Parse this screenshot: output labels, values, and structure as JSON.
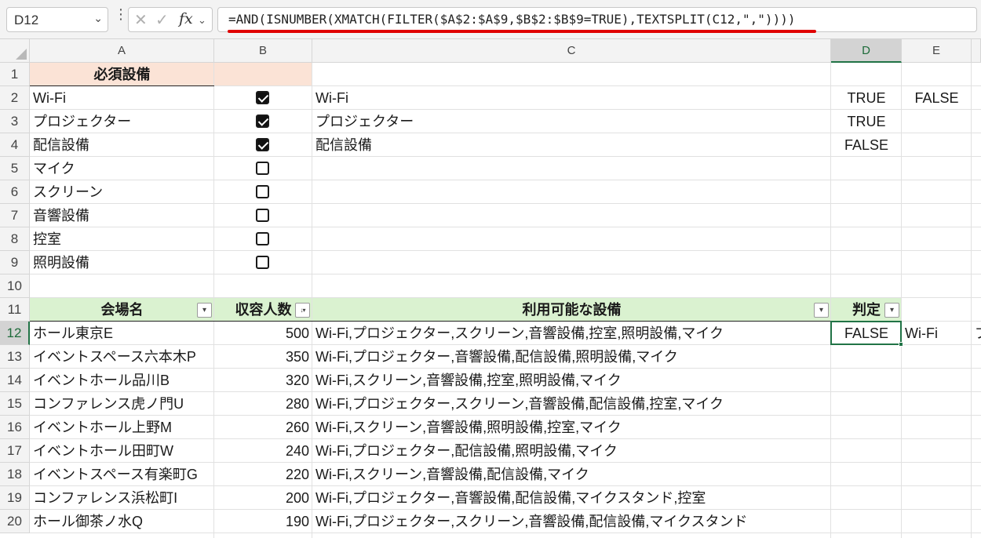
{
  "name_box": "D12",
  "formula": "=AND(ISNUMBER(XMATCH(FILTER($A$2:$A$9,$B$2:$B$9=TRUE),TEXTSPLIT(C12,\",\"))))",
  "columns": [
    "A",
    "B",
    "C",
    "D",
    "E"
  ],
  "rows": [
    "1",
    "2",
    "3",
    "4",
    "5",
    "6",
    "7",
    "8",
    "9",
    "10",
    "11",
    "12",
    "13",
    "14",
    "15",
    "16",
    "17",
    "18",
    "19",
    "20"
  ],
  "required_header": "必須設備",
  "equipment": [
    {
      "name": "Wi-Fi",
      "checked": true
    },
    {
      "name": "プロジェクター",
      "checked": true
    },
    {
      "name": "配信設備",
      "checked": true
    },
    {
      "name": "マイク",
      "checked": false
    },
    {
      "name": "スクリーン",
      "checked": false
    },
    {
      "name": "音響設備",
      "checked": false
    },
    {
      "name": "控室",
      "checked": false
    },
    {
      "name": "照明設備",
      "checked": false
    }
  ],
  "spill_c": [
    "Wi-Fi",
    "プロジェクター",
    "配信設備"
  ],
  "spill_d": [
    "TRUE",
    "TRUE",
    "FALSE"
  ],
  "e2": "FALSE",
  "table_headers": {
    "venue": "会場名",
    "capacity": "収容人数",
    "equipment": "利用可能な設備",
    "judgment": "判定"
  },
  "venues": [
    {
      "name": "ホール東京E",
      "capacity": "500",
      "equipment": "Wi-Fi,プロジェクター,スクリーン,音響設備,控室,照明設備,マイク"
    },
    {
      "name": "イベントスペース六本木P",
      "capacity": "350",
      "equipment": "Wi-Fi,プロジェクター,音響設備,配信設備,照明設備,マイク"
    },
    {
      "name": "イベントホール品川B",
      "capacity": "320",
      "equipment": "Wi-Fi,スクリーン,音響設備,控室,照明設備,マイク"
    },
    {
      "name": "コンファレンス虎ノ門U",
      "capacity": "280",
      "equipment": "Wi-Fi,プロジェクター,スクリーン,音響設備,配信設備,控室,マイク"
    },
    {
      "name": "イベントホール上野M",
      "capacity": "260",
      "equipment": "Wi-Fi,スクリーン,音響設備,照明設備,控室,マイク"
    },
    {
      "name": "イベントホール田町W",
      "capacity": "240",
      "equipment": "Wi-Fi,プロジェクター,配信設備,照明設備,マイク"
    },
    {
      "name": "イベントスペース有楽町G",
      "capacity": "220",
      "equipment": "Wi-Fi,スクリーン,音響設備,配信設備,マイク"
    },
    {
      "name": "コンファレンス浜松町I",
      "capacity": "200",
      "equipment": "Wi-Fi,プロジェクター,音響設備,配信設備,マイクスタンド,控室"
    },
    {
      "name": "ホール御茶ノ水Q",
      "capacity": "190",
      "equipment": "Wi-Fi,プロジェクター,スクリーン,音響設備,配信設備,マイクスタンド"
    }
  ],
  "d12": "FALSE",
  "e12": "Wi-Fi",
  "f12_partial": "プ",
  "colors": {
    "peach": "#fbe3d6",
    "green": "#daf2d0",
    "select": "#217346",
    "underline": "#e00000"
  }
}
